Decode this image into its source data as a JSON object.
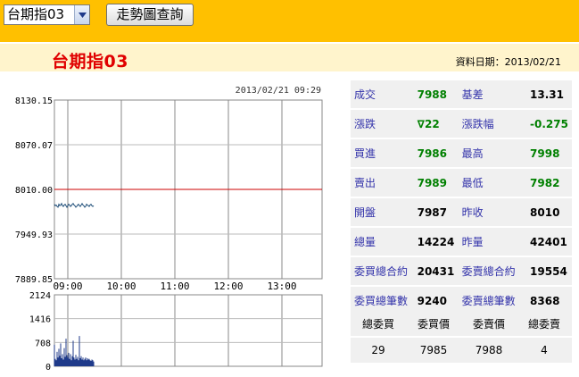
{
  "toolbar": {
    "select_value": "台期指03",
    "button_label": "走勢圖查詢"
  },
  "header": {
    "title": "台期指03",
    "date_label": "資料日期：2013/02/21"
  },
  "chart": {
    "timestamp": "2013/02/21 09:29"
  },
  "chart_data": [
    {
      "type": "line",
      "title": "",
      "xlabel": "",
      "ylabel": "",
      "x_ticks": [
        "09:00",
        "10:00",
        "11:00",
        "12:00",
        "13:00"
      ],
      "y_ticks": [
        "8130.15",
        "8070.07",
        "8010.00",
        "7949.93",
        "7889.85"
      ],
      "ylim": [
        7889.85,
        8130.15
      ],
      "reference_line": 8010.0,
      "x": [
        "08:45",
        "08:46",
        "08:47",
        "08:48",
        "08:49",
        "08:50",
        "08:51",
        "08:52",
        "08:53",
        "08:54",
        "08:55",
        "08:56",
        "08:57",
        "08:58",
        "08:59",
        "09:00",
        "09:01",
        "09:02",
        "09:03",
        "09:04",
        "09:05",
        "09:06",
        "09:07",
        "09:08",
        "09:09",
        "09:10",
        "09:11",
        "09:12",
        "09:13",
        "09:14",
        "09:15",
        "09:16",
        "09:17",
        "09:18",
        "09:19",
        "09:20",
        "09:21",
        "09:22",
        "09:23",
        "09:24",
        "09:25",
        "09:26",
        "09:27",
        "09:28",
        "09:29"
      ],
      "series": [
        {
          "values": [
            7990,
            7988,
            7989,
            7987,
            7986,
            7990,
            7988,
            7989,
            7991,
            7988,
            7987,
            7989,
            7990,
            7988,
            7986,
            7988,
            7990,
            7989,
            7987,
            7988,
            7990,
            7991,
            7989,
            7988,
            7986,
            7987,
            7989,
            7990,
            7988,
            7987,
            7989,
            7991,
            7989,
            7988,
            7986,
            7987,
            7990,
            7989,
            7988,
            7987,
            7989,
            7990,
            7988,
            7987,
            7988
          ]
        }
      ]
    },
    {
      "type": "bar",
      "title": "",
      "y_ticks": [
        "2124",
        "1416",
        "708",
        "0"
      ],
      "ylim": [
        0,
        2124
      ],
      "x": [
        "08:45",
        "08:46",
        "08:47",
        "08:48",
        "08:49",
        "08:50",
        "08:51",
        "08:52",
        "08:53",
        "08:54",
        "08:55",
        "08:56",
        "08:57",
        "08:58",
        "08:59",
        "09:00",
        "09:01",
        "09:02",
        "09:03",
        "09:04",
        "09:05",
        "09:06",
        "09:07",
        "09:08",
        "09:09",
        "09:10",
        "09:11",
        "09:12",
        "09:13",
        "09:14",
        "09:15",
        "09:16",
        "09:17",
        "09:18",
        "09:19",
        "09:20",
        "09:21",
        "09:22",
        "09:23",
        "09:24",
        "09:25",
        "09:26",
        "09:27",
        "09:28",
        "09:29"
      ],
      "series": [
        {
          "values": [
            640,
            220,
            180,
            430,
            260,
            520,
            310,
            680,
            240,
            360,
            200,
            540,
            280,
            820,
            330,
            260,
            400,
            220,
            360,
            180,
            300,
            760,
            260,
            200,
            340,
            220,
            280,
            180,
            900,
            240,
            300,
            200,
            260,
            180,
            220,
            260,
            180,
            240,
            200,
            220,
            180,
            160,
            200,
            180,
            140
          ]
        }
      ]
    }
  ],
  "quote": {
    "rows": [
      [
        {
          "l": "成交",
          "v": "7988",
          "c": "green"
        },
        {
          "l": "基差",
          "v": "13.31",
          "c": ""
        }
      ],
      [
        {
          "l": "漲跌",
          "v": "∇22",
          "c": "green"
        },
        {
          "l": "漲跌幅",
          "v": "-0.275",
          "c": "green"
        }
      ],
      [
        {
          "l": "買進",
          "v": "7986",
          "c": "green"
        },
        {
          "l": "最高",
          "v": "7998",
          "c": "green"
        }
      ],
      [
        {
          "l": "賣出",
          "v": "7989",
          "c": "green"
        },
        {
          "l": "最低",
          "v": "7982",
          "c": "green"
        }
      ],
      [
        {
          "l": "開盤",
          "v": "7987",
          "c": ""
        },
        {
          "l": "昨收",
          "v": "8010",
          "c": ""
        }
      ],
      [
        {
          "l": "總量",
          "v": "14224",
          "c": ""
        },
        {
          "l": "昨量",
          "v": "42401",
          "c": ""
        }
      ],
      [
        {
          "l": "委買總合約",
          "v": "20431",
          "c": ""
        },
        {
          "l": "委賣總合約",
          "v": "19554",
          "c": ""
        }
      ],
      [
        {
          "l": "委買總筆數",
          "v": "9240",
          "c": ""
        },
        {
          "l": "委賣總筆數",
          "v": "8368",
          "c": ""
        }
      ]
    ]
  },
  "order_book": {
    "headers": [
      "總委買",
      "委買價",
      "委賣價",
      "總委賣"
    ],
    "values": [
      "29",
      "7985",
      "7988",
      "4"
    ]
  },
  "colors": {
    "topbar": "#ffc000",
    "titlebar": "#fff4cc",
    "price_line": "#1f4e79",
    "reference_line": "#cc0000",
    "volume_bar": "#1f3a8a",
    "green": "#008000",
    "label_blue": "#3333aa"
  }
}
